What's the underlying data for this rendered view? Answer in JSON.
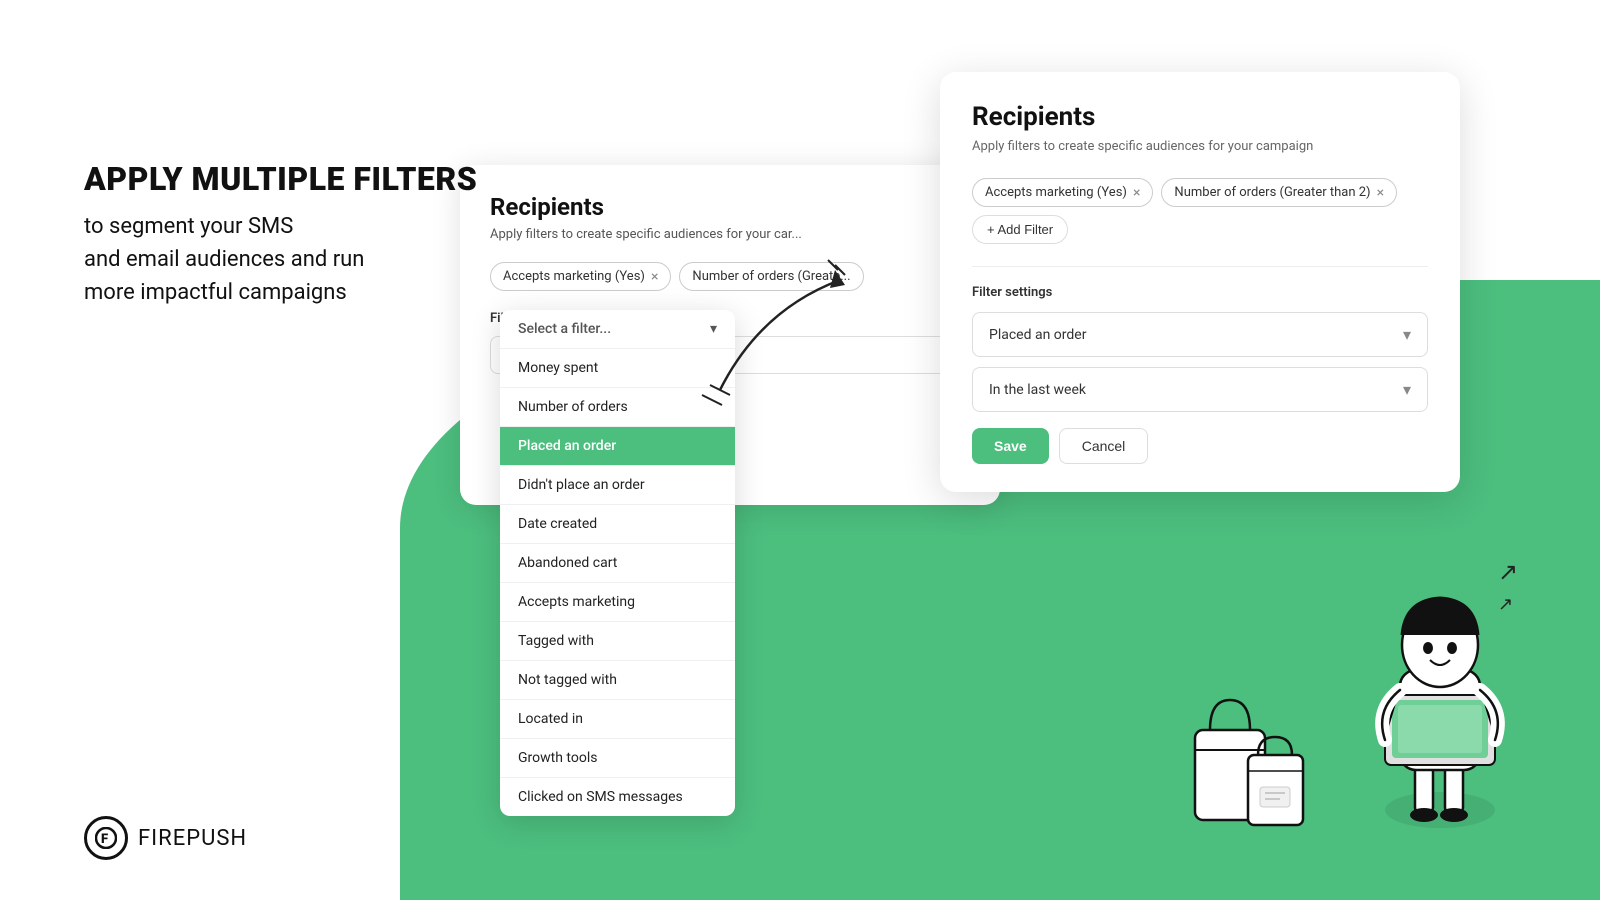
{
  "left": {
    "headline": "APPLY MULTIPLE FILTERS",
    "subtext_line1": "to segment your SMS",
    "subtext_line2": "and email audiences and run",
    "subtext_line3": "more impactful campaigns"
  },
  "logo": {
    "icon": "F",
    "brand": "FIRE",
    "brand2": "PUSH"
  },
  "card_back": {
    "title": "Recipients",
    "subtitle": "Apply filters to create specific audiences for your car...",
    "tags": [
      {
        "label": "Accepts marketing (Yes)",
        "x": "×"
      },
      {
        "label": "Number of orders (Greate...",
        "x": ""
      }
    ],
    "filter_settings_label": "Filter settings",
    "select_placeholder": "Select a filter..."
  },
  "dropdown": {
    "placeholder": "Select a filter...",
    "items": [
      {
        "label": "Money spent",
        "selected": false
      },
      {
        "label": "Number of orders",
        "selected": false
      },
      {
        "label": "Placed an order",
        "selected": true
      },
      {
        "label": "Didn't place an order",
        "selected": false
      },
      {
        "label": "Date created",
        "selected": false
      },
      {
        "label": "Abandoned cart",
        "selected": false
      },
      {
        "label": "Accepts marketing",
        "selected": false
      },
      {
        "label": "Tagged with",
        "selected": false
      },
      {
        "label": "Not tagged with",
        "selected": false
      },
      {
        "label": "Located in",
        "selected": false
      },
      {
        "label": "Growth tools",
        "selected": false
      },
      {
        "label": "Clicked on SMS messages",
        "selected": false
      }
    ]
  },
  "card_front": {
    "title": "Recipients",
    "subtitle": "Apply filters to create specific audiences for your campaign",
    "tags": [
      {
        "label": "Accepts marketing (Yes)",
        "x": "×"
      },
      {
        "label": "Number of orders (Greater than 2)",
        "x": "×"
      }
    ],
    "add_filter_label": "+ Add Filter",
    "filter_settings_label": "Filter settings",
    "placed_an_order": "Placed an order",
    "in_the_last_week": "In the last week",
    "save_label": "Save",
    "cancel_label": "Cancel"
  }
}
